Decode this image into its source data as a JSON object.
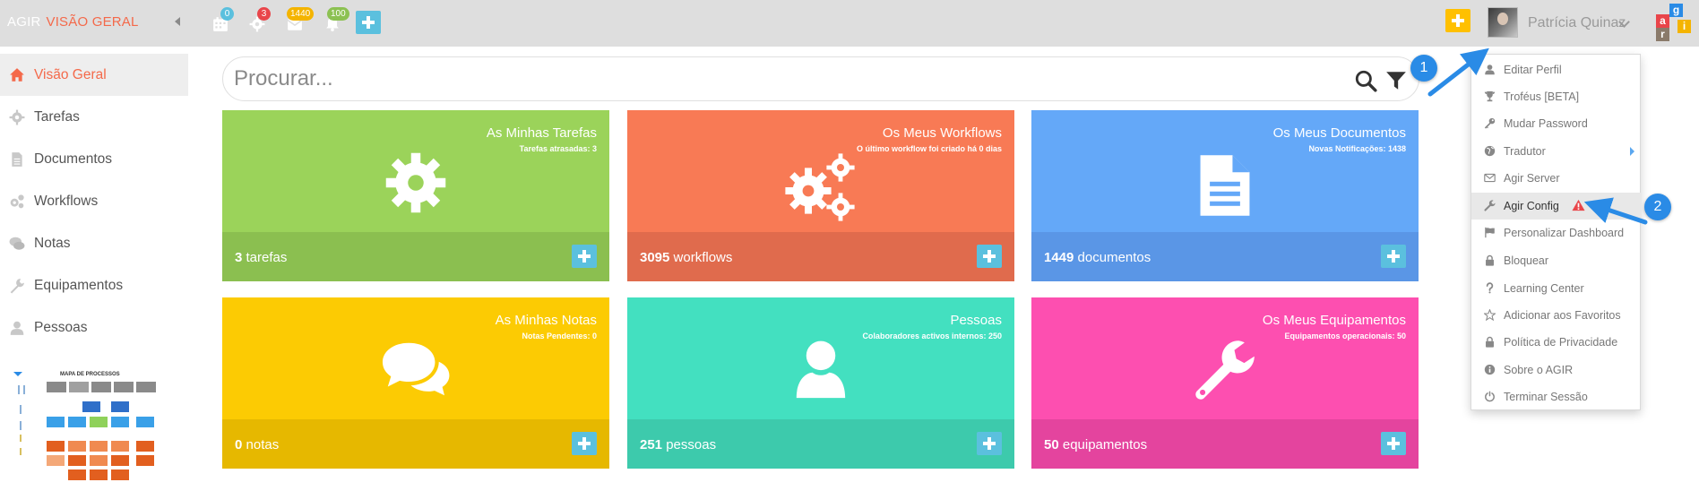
{
  "app": {
    "brand": "AGIR",
    "section": "VISÃO GERAL"
  },
  "topbar": {
    "calendar_badge": "0",
    "settings_badge": "3",
    "docs_badge": "1440",
    "notifications_badge": "100",
    "user_name": "Patrícia Quinaz",
    "logo_letters": [
      "a",
      "g",
      "r",
      "i"
    ]
  },
  "sidebar": {
    "items": [
      {
        "label": "Visão Geral",
        "icon": "home-icon"
      },
      {
        "label": "Tarefas",
        "icon": "gear-icon"
      },
      {
        "label": "Documentos",
        "icon": "document-icon"
      },
      {
        "label": "Workflows",
        "icon": "gears-icon"
      },
      {
        "label": "Notas",
        "icon": "comments-icon"
      },
      {
        "label": "Equipamentos",
        "icon": "wrench-icon"
      },
      {
        "label": "Pessoas",
        "icon": "user-icon"
      }
    ],
    "process_map_title": "MAPA DE PROCESSOS"
  },
  "search": {
    "placeholder": "Procurar..."
  },
  "tiles": [
    {
      "title": "As Minhas Tarefas",
      "subtitle": "Tarefas atrasadas: 3",
      "count": "3",
      "unit": "tarefas",
      "icon": "gear-icon",
      "color": "#9bd35a",
      "foot_color": "#8bbf50"
    },
    {
      "title": "Os Meus Workflows",
      "subtitle": "O último workflow foi criado há 0 dias",
      "count": "3095",
      "unit": "workflows",
      "icon": "gears-icon",
      "color": "#f87a55",
      "foot_color": "#e06b4d"
    },
    {
      "title": "Os Meus Documentos",
      "subtitle": "Novas Notificações: 1438",
      "count": "1449",
      "unit": "documentos",
      "icon": "document-icon",
      "color": "#64a8f8",
      "foot_color": "#5a96e6"
    },
    {
      "title": "As Minhas Notas",
      "subtitle": "Notas Pendentes: 0",
      "count": "0",
      "unit": "notas",
      "icon": "comments-icon",
      "color": "#fccb03",
      "foot_color": "#e6b800"
    },
    {
      "title": "Pessoas",
      "subtitle": "Colaboradores activos internos: 250",
      "count": "251",
      "unit": "pessoas",
      "icon": "user-icon",
      "color": "#43e0c0",
      "foot_color": "#3dcaac"
    },
    {
      "title": "Os Meus Equipamentos",
      "subtitle": "Equipamentos operacionais: 50",
      "count": "50",
      "unit": "equipamentos",
      "icon": "wrench-icon",
      "color": "#fd4fb0",
      "foot_color": "#e4449e"
    }
  ],
  "user_menu": {
    "items": [
      {
        "label": "Editar Perfil",
        "icon": "user-icon"
      },
      {
        "label": "Troféus [BETA]",
        "icon": "trophy-icon"
      },
      {
        "label": "Mudar Password",
        "icon": "key-icon"
      },
      {
        "label": "Tradutor",
        "icon": "globe-icon"
      },
      {
        "label": "Agir Server",
        "icon": "envelope-icon"
      },
      {
        "label": "Agir Config",
        "icon": "wrench-icon"
      },
      {
        "label": "Personalizar Dashboard",
        "icon": "flag-icon"
      },
      {
        "label": "Bloquear",
        "icon": "lock-icon"
      },
      {
        "label": "Learning Center",
        "icon": "question-icon"
      },
      {
        "label": "Adicionar aos Favoritos",
        "icon": "star-icon"
      },
      {
        "label": "Política de Privacidade",
        "icon": "lock-icon"
      },
      {
        "label": "Sobre o AGIR",
        "icon": "info-icon"
      },
      {
        "label": "Terminar Sessão",
        "icon": "power-icon"
      }
    ]
  },
  "annotations": {
    "step1": "1",
    "step2": "2"
  },
  "colors": {
    "accent": "#f4694a",
    "topbar": "#dedede",
    "info": "#5bc0de",
    "warning": "#ffc000",
    "step": "#2a8be6"
  }
}
